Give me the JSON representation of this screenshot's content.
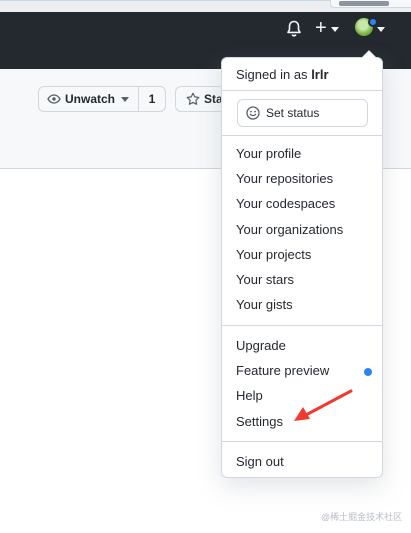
{
  "header": {
    "bell_icon": "bell-icon",
    "plus_label": "+",
    "avatar_icon": "avatar"
  },
  "repo_actions": {
    "watch_label": "Unwatch",
    "watch_count": "1",
    "star_label": "Star"
  },
  "menu": {
    "signed_in_prefix": "Signed in as",
    "username": "lrlr",
    "set_status_label": "Set status",
    "profile_items": [
      "Your profile",
      "Your repositories",
      "Your codespaces",
      "Your organizations",
      "Your projects",
      "Your stars",
      "Your gists"
    ],
    "misc_items": [
      "Upgrade",
      "Feature preview",
      "Help",
      "Settings"
    ],
    "sign_out_label": "Sign out"
  },
  "colors": {
    "header_bg": "#24292f",
    "accent_blue": "#2f81f7",
    "annotation_red": "#f03a2f"
  },
  "watermark": "@稀土掘金技术社区"
}
